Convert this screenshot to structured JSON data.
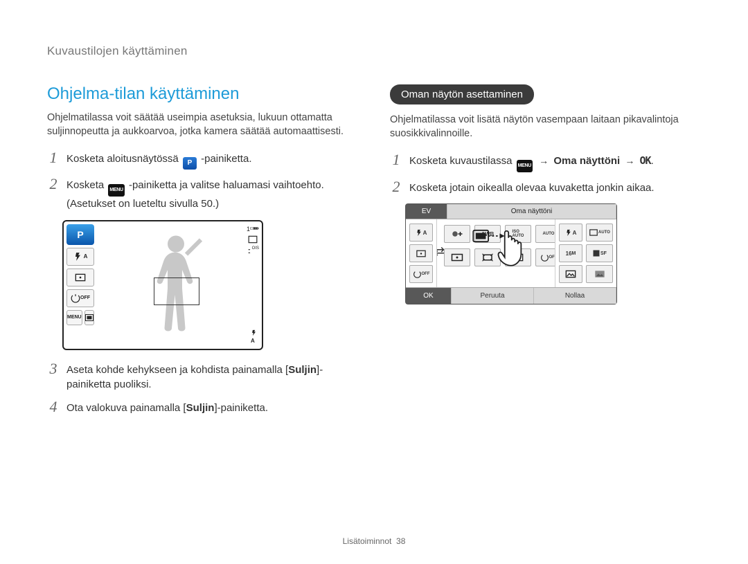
{
  "breadcrumb": "Kuvaustilojen käyttäminen",
  "left": {
    "title": "Ohjelma-tilan käyttäminen",
    "lead": "Ohjelmatilassa voit säätää useimpia asetuksia, lukuun ottamatta suljinnopeutta ja aukkoarvoa, jotka kamera säätää automaattisesti.",
    "step1_a": "Kosketa aloitusnäytössä ",
    "step1_b": "-painiketta.",
    "step2_a": "Kosketa ",
    "step2_b": "-painiketta ja valitse haluamasi vaihtoehto. (Asetukset on lueteltu sivulla 50.)",
    "step3_a": "Aseta kohde kehykseen ja kohdista painamalla [",
    "step3_bold": "Suljin",
    "step3_b": "]-painiketta puoliksi.",
    "step4_a": "Ota valokuva painamalla [",
    "step4_bold": "Suljin",
    "step4_b": "]-painiketta.",
    "menu_label": "MENU"
  },
  "right": {
    "pill": "Oman näytön asettaminen",
    "lead": "Ohjelmatilassa voit lisätä näytön vasempaan laitaan pikavalintoja suosikkivalinnoille.",
    "step1_a": "Kosketa kuvaustilassa ",
    "step1_arrow": "→",
    "step1_bold": " Oma näyttöni ",
    "step1_end": ".",
    "step2": "Kosketa jotain oikealla olevaa kuvaketta jonkin aikaa.",
    "tabs": {
      "ev": "EV",
      "label": "Oma näyttöni"
    },
    "foot": {
      "ok": "OK",
      "cancel": "Peruuta",
      "reset": "Nollaa"
    }
  },
  "icons": {
    "p": "P",
    "menu": "MENU",
    "ok": "OK"
  },
  "footer": {
    "label": "Lisätoiminnot",
    "page": "38"
  }
}
